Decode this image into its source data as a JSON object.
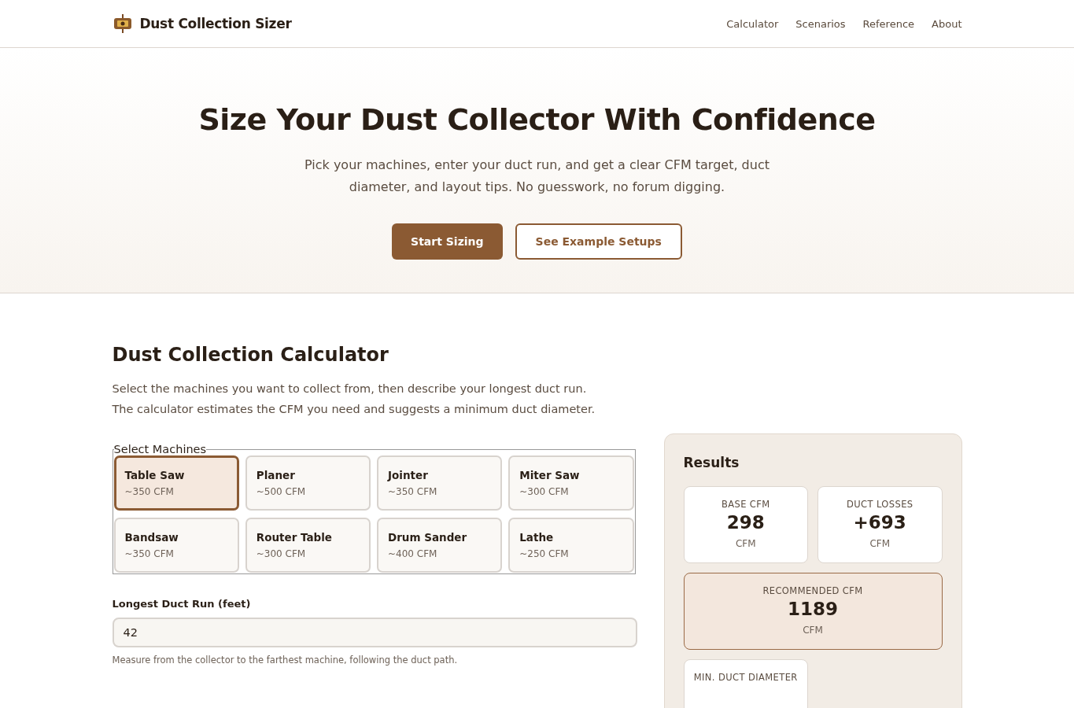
{
  "header": {
    "brand": "Dust Collection Sizer",
    "nav": [
      {
        "label": "Calculator"
      },
      {
        "label": "Scenarios"
      },
      {
        "label": "Reference"
      },
      {
        "label": "About"
      }
    ]
  },
  "hero": {
    "title": "Size Your Dust Collector With Confidence",
    "subtitle": "Pick your machines, enter your duct run, and get a clear CFM target, duct diameter, and layout tips. No guesswork, no forum digging.",
    "buttons": [
      {
        "label": "Start Sizing",
        "kind": "primary"
      },
      {
        "label": "See Example Setups",
        "kind": "secondary"
      }
    ]
  },
  "calculator": {
    "title": "Dust Collection Calculator",
    "intro": "Select the machines you want to collect from, then describe your longest duct run. The calculator estimates the CFM you need and suggests a minimum duct diameter.",
    "machines_legend": "Select Machines",
    "machines": [
      {
        "name": "Table Saw",
        "cfm": "~350 CFM",
        "selected": true
      },
      {
        "name": "Planer",
        "cfm": "~500 CFM",
        "selected": false
      },
      {
        "name": "Jointer",
        "cfm": "~350 CFM",
        "selected": false
      },
      {
        "name": "Miter Saw",
        "cfm": "~300 CFM",
        "selected": false
      },
      {
        "name": "Bandsaw",
        "cfm": "~350 CFM",
        "selected": false
      },
      {
        "name": "Router Table",
        "cfm": "~300 CFM",
        "selected": false
      },
      {
        "name": "Drum Sander",
        "cfm": "~400 CFM",
        "selected": false
      },
      {
        "name": "Lathe",
        "cfm": "~250 CFM",
        "selected": false
      }
    ],
    "duct_run": {
      "label": "Longest Duct Run (feet)",
      "value": "42",
      "hint": "Measure from the collector to the farthest machine, following the duct path."
    }
  },
  "results": {
    "title": "Results",
    "cards": [
      {
        "label": "BASE CFM",
        "value": "298",
        "unit": "CFM",
        "kind": "normal"
      },
      {
        "label": "DUCT LOSSES",
        "value": "+693",
        "unit": "CFM",
        "kind": "normal"
      },
      {
        "label": "RECOMMENDED CFM",
        "value": "1189",
        "unit": "CFM",
        "kind": "highlight"
      },
      {
        "label": "MIN. DUCT DIAMETER",
        "kind": "normal"
      }
    ]
  }
}
